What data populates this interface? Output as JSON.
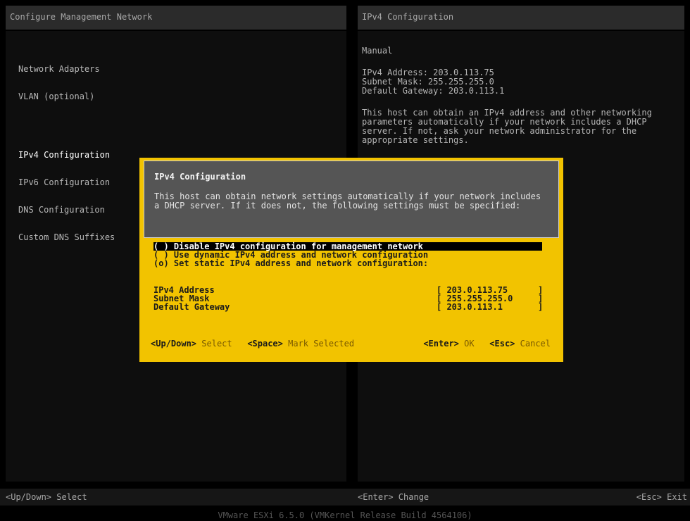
{
  "header": {
    "left_title": "Configure Management Network",
    "right_title": "IPv4 Configuration"
  },
  "menu": {
    "items": [
      "Network Adapters",
      "VLAN (optional)",
      "IPv4 Configuration",
      "IPv6 Configuration",
      "DNS Configuration",
      "Custom DNS Suffixes"
    ]
  },
  "info": {
    "mode": "Manual",
    "ipv4_address": "IPv4 Address: 203.0.113.75",
    "subnet_mask": "Subnet Mask: 255.255.255.0",
    "default_gateway": "Default Gateway: 203.0.113.1",
    "description": "This host can obtain an IPv4 address and other networking parameters automatically if your network includes a DHCP server. If not, ask your network administrator for the appropriate settings."
  },
  "dialog": {
    "title": "IPv4 Configuration",
    "description": "This host can obtain network settings automatically if your network includes a DHCP server. If it does not, the following settings must be specified:",
    "options": [
      "( ) Disable IPv4 configuration for management network",
      "( ) Use dynamic IPv4 address and network configuration",
      "(o) Set static IPv4 address and network configuration:"
    ],
    "fields": [
      {
        "label": "IPv4 Address",
        "value": "203.0.113.75"
      },
      {
        "label": "Subnet Mask",
        "value": "255.255.255.0"
      },
      {
        "label": "Default Gateway",
        "value": "203.0.113.1"
      }
    ],
    "footer": {
      "updown_key": "<Up/Down>",
      "updown_action": "Select",
      "space_key": "<Space>",
      "space_action": "Mark Selected",
      "enter_key": "<Enter>",
      "enter_action": "OK",
      "esc_key": "<Esc>",
      "esc_action": "Cancel"
    }
  },
  "bottom": {
    "left": "<Up/Down> Select",
    "center": "<Enter> Change",
    "right": "<Esc> Exit"
  },
  "footer_text": "VMware ESXi 6.5.0 (VMKernel Release Build 4564106)",
  "colors": {
    "dialog_bg": "#f2c300",
    "dialog_header_bg": "#555555",
    "selection_bg": "#000000"
  }
}
